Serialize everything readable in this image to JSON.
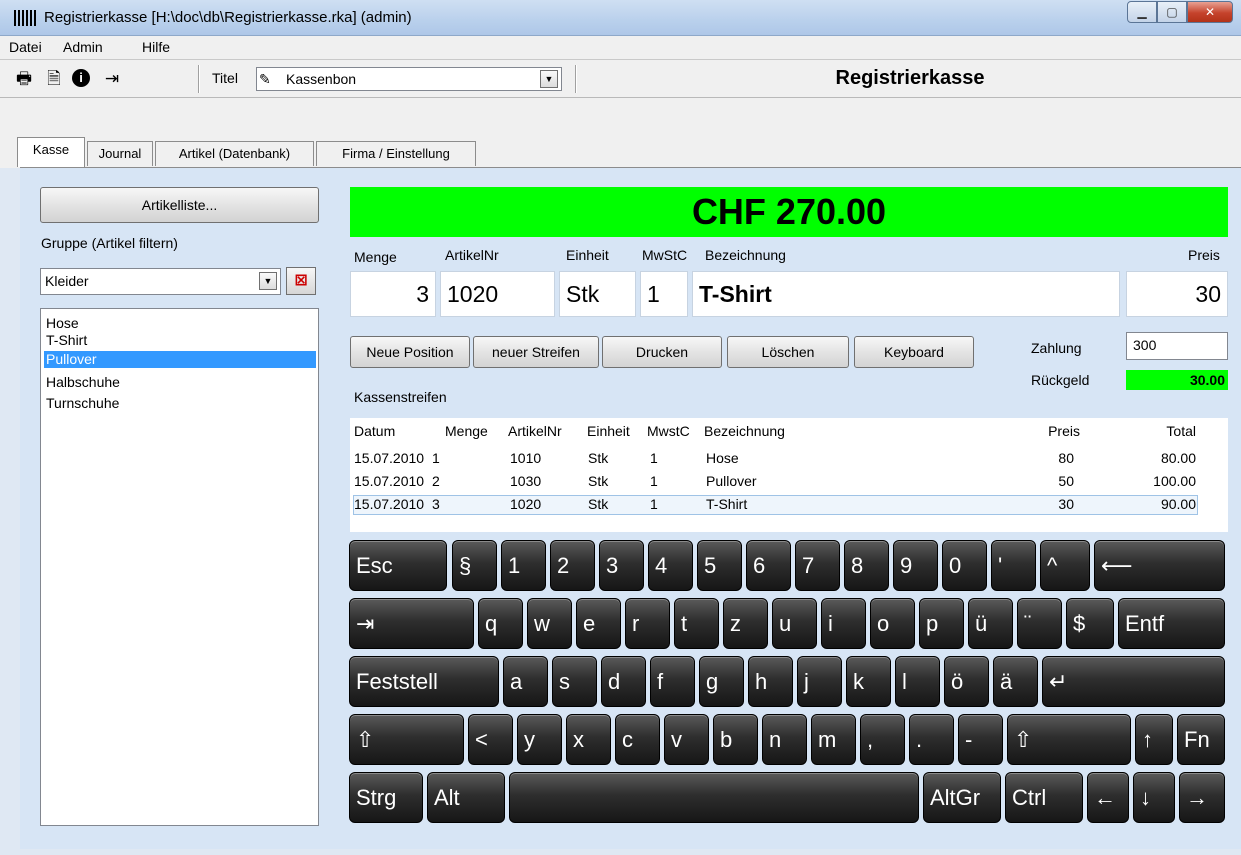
{
  "window": {
    "title": "Registrierkasse [H:\\doc\\db\\Registrierkasse.rka] (admin)"
  },
  "menu": [
    "Datei",
    "Admin",
    "Hilfe"
  ],
  "toolbar": {
    "titel_label": "Titel",
    "titel_value": "Kassenbon",
    "app_title": "Registrierkasse"
  },
  "tabs": [
    "Kasse",
    "Journal",
    "Artikel (Datenbank)",
    "Firma / Einstellung"
  ],
  "left": {
    "artikelliste_button": "Artikelliste...",
    "gruppe_label": "Gruppe (Artikel filtern)",
    "gruppe_value": "Kleider",
    "items": [
      "Hose",
      "T-Shirt",
      "Pullover",
      "Halbschuhe",
      "Turnschuhe"
    ],
    "selected_item": "Pullover"
  },
  "total": "CHF 270.00",
  "entry": {
    "labels": {
      "menge": "Menge",
      "artikelnr": "ArtikelNr",
      "einheit": "Einheit",
      "mwstc": "MwStC",
      "bezeichnung": "Bezeichnung",
      "preis": "Preis"
    },
    "values": {
      "menge": "3",
      "artikelnr": "1020",
      "einheit": "Stk",
      "mwstc": "1",
      "bezeichnung": "T-Shirt",
      "preis": "30"
    }
  },
  "buttons": [
    "Neue Position",
    "neuer Streifen",
    "Drucken",
    "Löschen",
    "Keyboard"
  ],
  "payment": {
    "zahlung_label": "Zahlung",
    "zahlung_value": "300",
    "rueckgeld_label": "Rückgeld",
    "rueckgeld_value": "30.00"
  },
  "kassenstreifen": {
    "label": "Kassenstreifen",
    "columns": [
      "Datum",
      "Menge",
      "ArtikelNr",
      "Einheit",
      "MwstC",
      "Bezeichnung",
      "Preis",
      "Total"
    ],
    "rows": [
      [
        "15.07.2010",
        "1",
        "1010",
        "Stk",
        "1",
        "Hose",
        "80",
        "80.00"
      ],
      [
        "15.07.2010",
        "2",
        "1030",
        "Stk",
        "1",
        "Pullover",
        "50",
        "100.00"
      ],
      [
        "15.07.2010",
        "3",
        "1020",
        "Stk",
        "1",
        "T-Shirt",
        "30",
        "90.00"
      ]
    ]
  },
  "keyboard": {
    "row1": [
      "Esc",
      "§",
      "1",
      "2",
      "3",
      "4",
      "5",
      "6",
      "7",
      "8",
      "9",
      "0",
      "'",
      "^",
      "⟵"
    ],
    "row2": [
      "⇥",
      "q",
      "w",
      "e",
      "r",
      "t",
      "z",
      "u",
      "i",
      "o",
      "p",
      "ü",
      "¨",
      "$",
      "Entf"
    ],
    "row3": [
      "Feststell",
      "a",
      "s",
      "d",
      "f",
      "g",
      "h",
      "j",
      "k",
      "l",
      "ö",
      "ä",
      "↵"
    ],
    "row4": [
      "⇧",
      "<",
      "y",
      "x",
      "c",
      "v",
      "b",
      "n",
      "m",
      ",",
      ".",
      "-",
      "⇧",
      "↑",
      "Fn"
    ],
    "row5": [
      "Strg",
      "Alt",
      "",
      "AltGr",
      "Ctrl",
      "←",
      "↓",
      "→"
    ]
  }
}
